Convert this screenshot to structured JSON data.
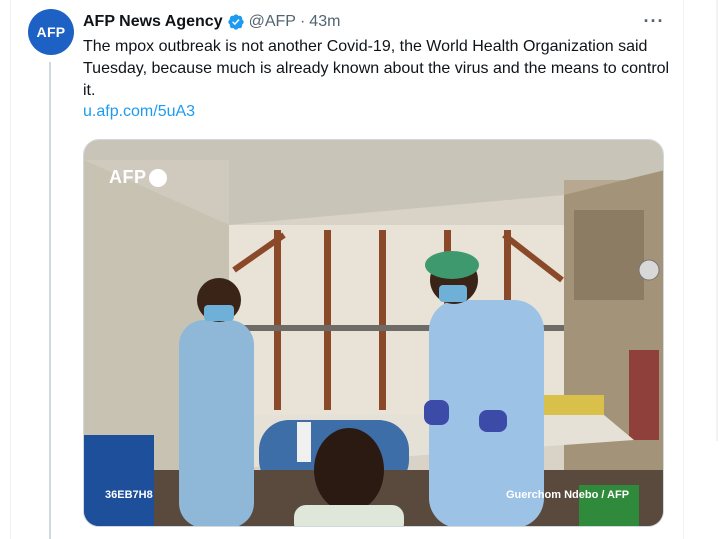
{
  "tweet": {
    "avatar_text": "AFP",
    "author_name": "AFP News Agency",
    "handle": "@AFP",
    "separator": "·",
    "time": "43m",
    "more_icon": "···",
    "text": "The mpox outbreak is not another Covid-19, the World Health Organization said Tuesday, because much is already known about the virus and the means to control it.",
    "link": "u.afp.com/5uA3"
  },
  "media": {
    "logo_text": "AFP",
    "photo_code": "36EB7H8",
    "credit": "Guerchom Ndebo / AFP"
  },
  "colors": {
    "name": "#0f1419",
    "muted": "#536471",
    "link": "#1d9bf0",
    "verified": "#1d9bf0",
    "avatar": "#1d61c4"
  },
  "icons": [
    "verified-badge-icon",
    "more-options-icon"
  ]
}
